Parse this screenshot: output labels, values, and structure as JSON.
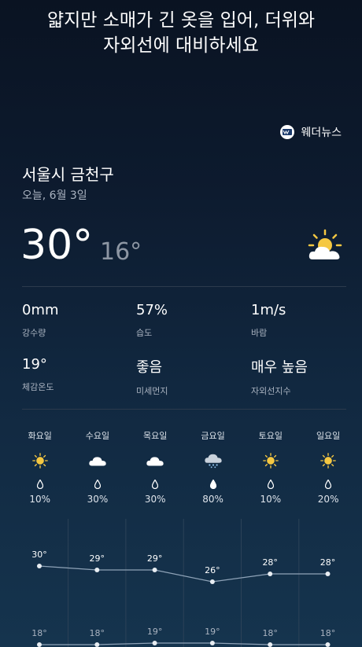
{
  "headline": {
    "line1": "얇지만 소매가 긴 옷을 입어, 더위와",
    "line2": "자외선에 대비하세요"
  },
  "brand": {
    "name": "웨더뉴스"
  },
  "location": "서울시 금천구",
  "date": "오늘, 6월 3일",
  "current": {
    "temp": "30°",
    "low": "16°",
    "icon": "partly-cloudy-icon"
  },
  "stats": [
    {
      "value": "0mm",
      "label": "강수량"
    },
    {
      "value": "57%",
      "label": "습도"
    },
    {
      "value": "1m/s",
      "label": "바람"
    },
    {
      "value": "19°",
      "label": "체감온도"
    },
    {
      "value": "좋음",
      "label": "미세먼지"
    },
    {
      "value": "매우 높음",
      "label": "자외선지수"
    }
  ],
  "forecast": [
    {
      "day": "화요일",
      "icon": "sun-icon",
      "pop": "10%",
      "high": "30°",
      "low": "18°",
      "high_value": 30,
      "low_value": 18
    },
    {
      "day": "수요일",
      "icon": "cloud-icon",
      "pop": "30%",
      "high": "29°",
      "low": "18°",
      "high_value": 29,
      "low_value": 18
    },
    {
      "day": "목요일",
      "icon": "cloud-icon",
      "pop": "30%",
      "high": "29°",
      "low": "19°",
      "high_value": 29,
      "low_value": 19
    },
    {
      "day": "금요일",
      "icon": "rain-cloud-icon",
      "pop": "80%",
      "high": "26°",
      "low": "19°",
      "high_value": 26,
      "low_value": 19
    },
    {
      "day": "토요일",
      "icon": "sun-icon",
      "pop": "10%",
      "high": "28°",
      "low": "18°",
      "high_value": 28,
      "low_value": 18
    },
    {
      "day": "일요일",
      "icon": "sun-icon",
      "pop": "20%",
      "high": "28°",
      "low": "18°",
      "high_value": 28,
      "low_value": 18
    }
  ],
  "colors": {
    "sun": "#f5c842",
    "cloud": "#ffffff",
    "line": "#8fa3b8",
    "secondary_text": "#aab3c0"
  }
}
